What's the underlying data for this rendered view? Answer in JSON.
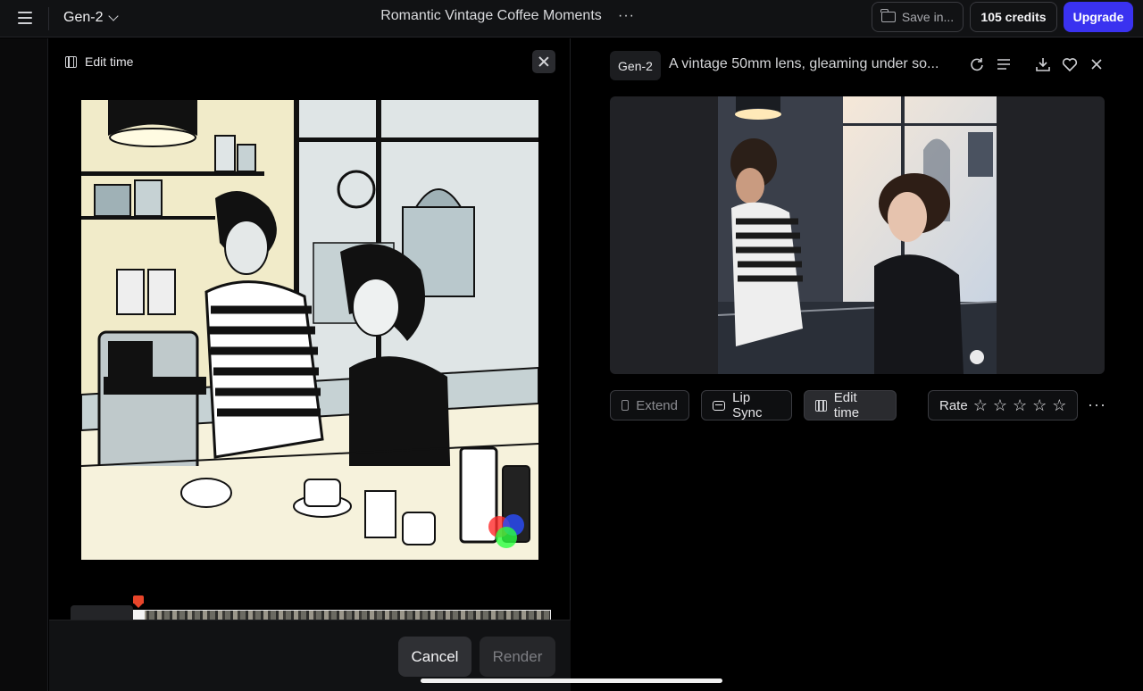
{
  "topbar": {
    "model": "Gen-2",
    "project_title": "Romantic Vintage Coffee Moments",
    "more": "···",
    "save_label": "Save in...",
    "credits_label": "105 credits",
    "upgrade_label": "Upgrade"
  },
  "edit_panel": {
    "title": "Edit time",
    "cancel_label": "Cancel",
    "render_label": "Render"
  },
  "right_panel": {
    "model_chip": "Gen-2",
    "prompt": "A vintage 50mm lens, gleaming under so...",
    "actions": {
      "extend_label": "Extend",
      "lipsync_label": "Lip Sync",
      "edittime_label": "Edit time",
      "rate_label": "Rate",
      "more": "···"
    },
    "rating_stars": 5
  },
  "icons": [
    "menu-icon",
    "chevron-down-icon",
    "folder-icon",
    "film-icon",
    "close-icon",
    "regenerate-icon",
    "details-icon",
    "download-icon",
    "heart-icon",
    "extend-icon",
    "lipsync-icon",
    "star-icon",
    "more-icon"
  ],
  "colors": {
    "accent": "#3a32f0",
    "playhead": "#e8452a",
    "background": "#000000",
    "panel": "#111214"
  }
}
